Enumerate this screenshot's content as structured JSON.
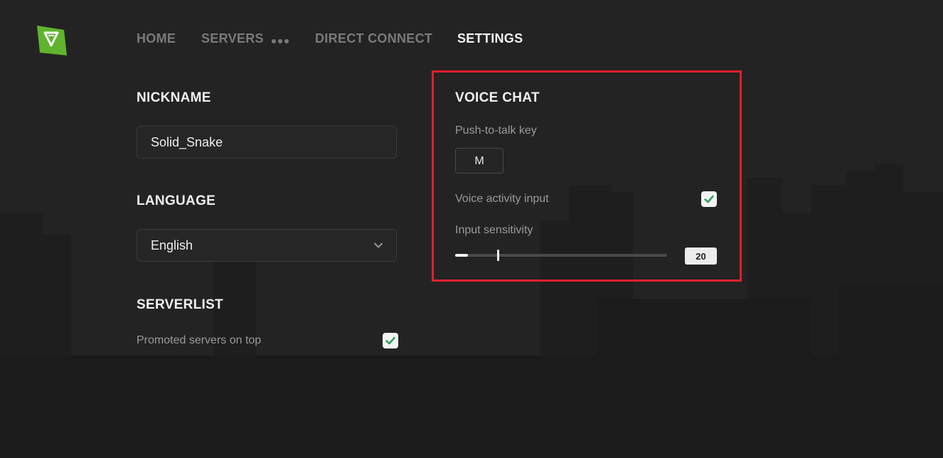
{
  "app": {
    "logo_icon": "v-logo-icon",
    "accent_color": "#5fb32e"
  },
  "nav": {
    "home": "HOME",
    "servers": "SERVERS",
    "more_icon": "more-dots-icon",
    "direct_connect": "DIRECT CONNECT",
    "settings": "SETTINGS",
    "active": "SETTINGS"
  },
  "nickname": {
    "title": "NICKNAME",
    "value": "Solid_Snake"
  },
  "language": {
    "title": "LANGUAGE",
    "selected": "English",
    "icon": "chevron-down-icon"
  },
  "serverlist": {
    "title": "SERVERLIST",
    "promoted_label": "Promoted servers on top",
    "promoted_checked": true
  },
  "voice_chat": {
    "title": "VOICE CHAT",
    "ptt_label": "Push-to-talk key",
    "ptt_key": "M",
    "activity_label": "Voice activity input",
    "activity_checked": true,
    "sensitivity_label": "Input sensitivity",
    "sensitivity_value": "20",
    "sensitivity_fraction": 0.2,
    "level_fraction": 0.06
  },
  "colors": {
    "check": "#2ea05a",
    "highlight": "#e02027"
  }
}
